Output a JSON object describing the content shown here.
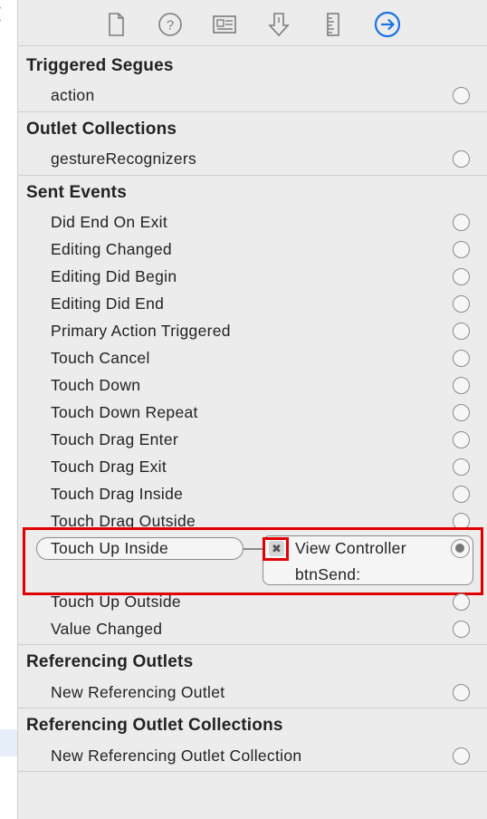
{
  "toolbar": {
    "icons": [
      "file-inspector-icon",
      "quick-help-icon",
      "identity-inspector-icon",
      "attributes-inspector-icon",
      "size-inspector-icon",
      "connections-inspector-icon"
    ],
    "active_color": "#1a73e8"
  },
  "sections": {
    "triggered_segues": {
      "title": "Triggered Segues",
      "items": [
        "action"
      ]
    },
    "outlet_collections": {
      "title": "Outlet Collections",
      "items": [
        "gestureRecognizers"
      ]
    },
    "sent_events": {
      "title": "Sent Events",
      "items": [
        "Did End On Exit",
        "Editing Changed",
        "Editing Did Begin",
        "Editing Did End",
        "Primary Action Triggered",
        "Touch Cancel",
        "Touch Down",
        "Touch Down Repeat",
        "Touch Drag Enter",
        "Touch Drag Exit",
        "Touch Drag Inside",
        "Touch Drag Outside",
        "Touch Up Inside",
        "Touch Up Outside",
        "Value Changed"
      ]
    },
    "referencing_outlets": {
      "title": "Referencing Outlets",
      "items": [
        "New Referencing Outlet"
      ]
    },
    "referencing_outlet_collections": {
      "title": "Referencing Outlet Collections",
      "items": [
        "New Referencing Outlet Collection"
      ]
    }
  },
  "connection": {
    "event": "Touch Up Inside",
    "target": "View Controller",
    "action": "btnSend:",
    "remove_glyph": "✖"
  },
  "colors": {
    "annotation": "#e00000",
    "accent": "#1a73e8"
  }
}
